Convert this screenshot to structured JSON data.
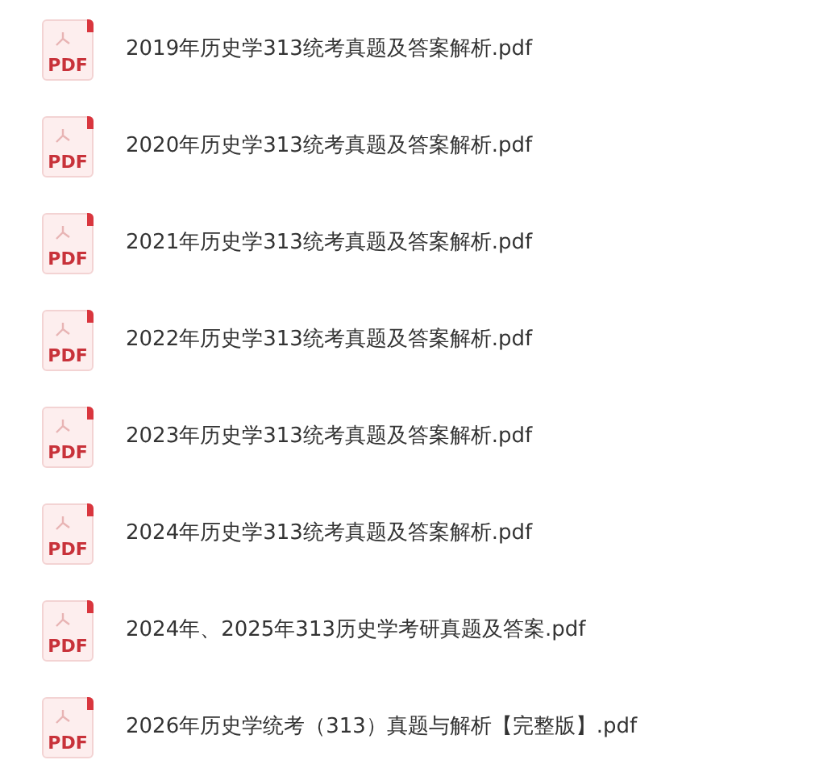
{
  "files": [
    {
      "name": "2019年历史学313统考真题及答案解析.pdf",
      "icon_label": "PDF"
    },
    {
      "name": "2020年历史学313统考真题及答案解析.pdf",
      "icon_label": "PDF"
    },
    {
      "name": "2021年历史学313统考真题及答案解析.pdf",
      "icon_label": "PDF"
    },
    {
      "name": "2022年历史学313统考真题及答案解析.pdf",
      "icon_label": "PDF"
    },
    {
      "name": "2023年历史学313统考真题及答案解析.pdf",
      "icon_label": "PDF"
    },
    {
      "name": "2024年历史学313统考真题及答案解析.pdf",
      "icon_label": "PDF"
    },
    {
      "name": "2024年、2025年313历史学考研真题及答案.pdf",
      "icon_label": "PDF"
    },
    {
      "name": "2026年历史学统考（313）真题与解析【完整版】.pdf",
      "icon_label": "PDF"
    }
  ]
}
